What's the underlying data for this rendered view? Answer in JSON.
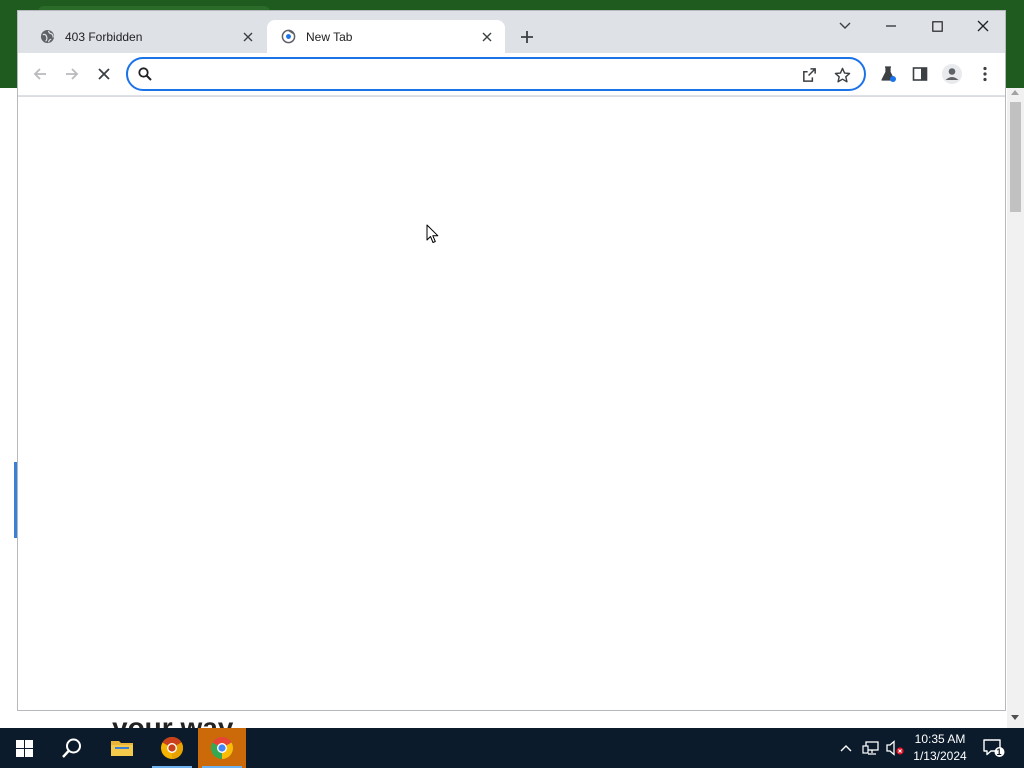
{
  "tabs": [
    {
      "title": "403 Forbidden",
      "favicon": "globe-icon",
      "active": false
    },
    {
      "title": "New Tab",
      "favicon": "chrome-newtab-icon",
      "active": true
    }
  ],
  "omnibox": {
    "value": "",
    "placeholder": ""
  },
  "background": {
    "bottom_text": "your way"
  },
  "taskbar": {
    "time": "10:35 AM",
    "date": "1/13/2024",
    "notification_count": "1"
  },
  "colors": {
    "accent": "#1a73e8",
    "taskbar": "#0b1b2c",
    "taskbar_active": "#cc6a0a",
    "tab_strip": "#dee1e6"
  }
}
